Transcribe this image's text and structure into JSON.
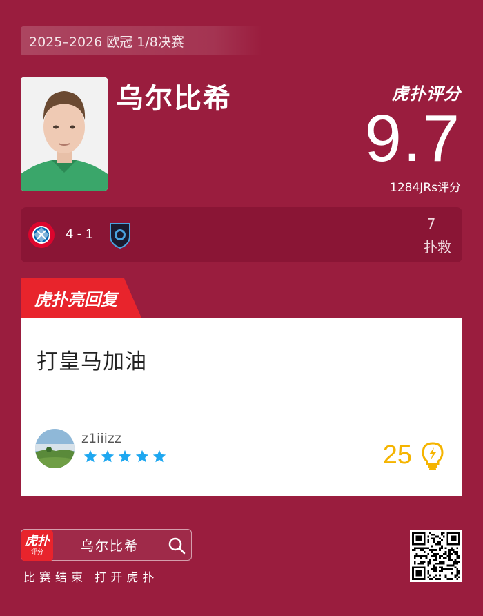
{
  "competition": {
    "title": "2025–2026 欧冠 1/8决赛"
  },
  "player": {
    "name": "乌尔比希"
  },
  "brand": {
    "logo_text": "虎扑评分"
  },
  "rating": {
    "value": "9.7",
    "count_label": "1284JRs评分"
  },
  "match": {
    "home_team_icon": "bayern-munich-badge",
    "away_team_icon": "atalanta-badge",
    "score": "4 - 1",
    "stat_value": "7",
    "stat_label": "扑救"
  },
  "highlight": {
    "tab_label": "虎扑亮回复",
    "reply_text": "打皇马加油",
    "username": "z1iiizz",
    "star_count": 5,
    "likes": "25"
  },
  "footer": {
    "app_icon_logo": "虎扑",
    "app_icon_sub": "评分",
    "search_text": "乌尔比希",
    "cta": "比赛结束 打开虎扑"
  },
  "colors": {
    "background": "#9a1d3e",
    "accent_red": "#e8242c",
    "star_blue": "#1ea7f0",
    "like_gold": "#f5b400"
  }
}
